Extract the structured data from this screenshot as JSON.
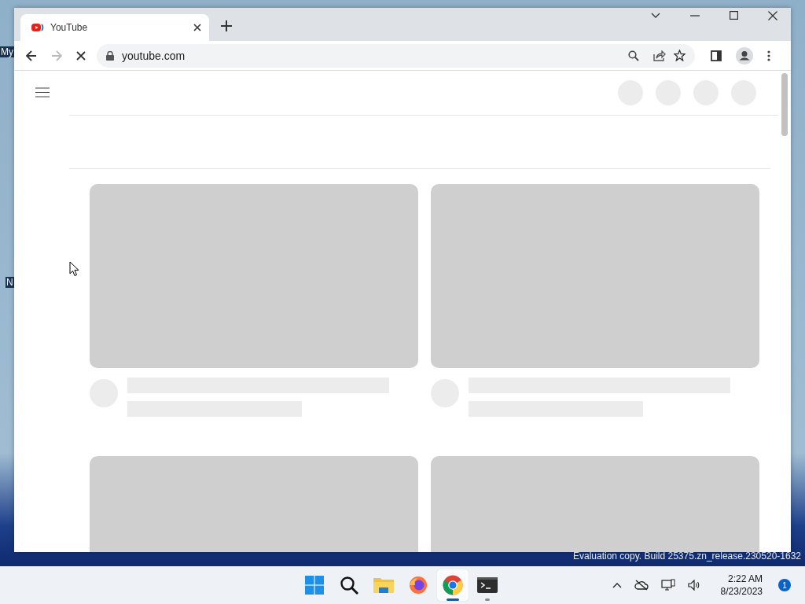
{
  "desktop": {
    "icon_labels": [
      "My",
      "N"
    ],
    "watermark": "Evaluation copy. Build 25375.zn_release.230520-1632"
  },
  "browser": {
    "tabs": [
      {
        "title": "YouTube",
        "selected": true
      }
    ],
    "address": "youtube.com",
    "loading": true,
    "forward_disabled": true
  },
  "page": {
    "header_placeholders": [
      {
        "kind": "circle"
      },
      {
        "kind": "circle"
      },
      {
        "kind": "circle"
      },
      {
        "kind": "circle"
      }
    ],
    "cards": [
      {
        "kind": "placeholder"
      },
      {
        "kind": "placeholder"
      },
      {
        "kind": "thumbnail_only"
      },
      {
        "kind": "thumbnail_only"
      }
    ]
  },
  "taskbar": {
    "apps": [
      {
        "kind": "start",
        "selected": false,
        "running": false
      },
      {
        "kind": "search",
        "selected": false,
        "running": false
      },
      {
        "kind": "files",
        "selected": false,
        "running": false
      },
      {
        "kind": "firefox",
        "selected": false,
        "running": false
      },
      {
        "kind": "chrome",
        "selected": true,
        "running": true
      },
      {
        "kind": "terminal",
        "selected": false,
        "running": true
      }
    ],
    "time": "2:22 AM",
    "date": "8/23/2023",
    "notification_count": "1"
  }
}
